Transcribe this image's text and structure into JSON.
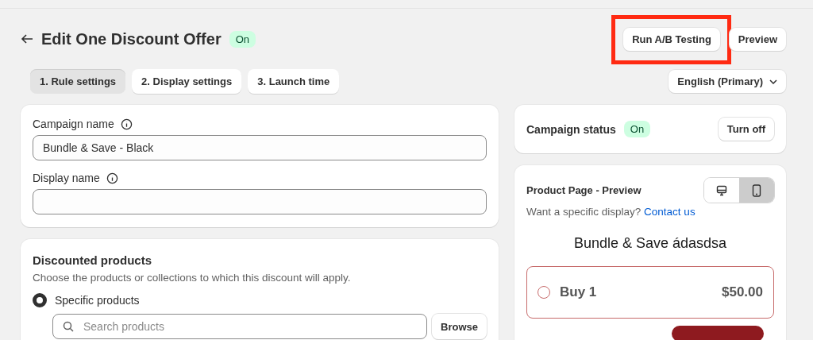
{
  "header": {
    "title": "Edit One Discount Offer",
    "status_badge": "On",
    "buttons": [
      {
        "label": "Run A/B Testing",
        "highlighted": true
      },
      {
        "label": "Preview",
        "highlighted": false
      }
    ]
  },
  "steps": [
    {
      "label": "1. Rule settings",
      "selected": true
    },
    {
      "label": "2. Display settings",
      "selected": false
    },
    {
      "label": "3. Launch time",
      "selected": false
    }
  ],
  "language_select": {
    "value": "English (Primary)"
  },
  "campaign_card": {
    "fields": [
      {
        "label": "Campaign name",
        "value": "Bundle & Save - Black"
      },
      {
        "label": "Display name"
      }
    ]
  },
  "discounted_products": {
    "title": "Discounted products",
    "description": "Choose the products or collections to which this discount will apply.",
    "options": [
      {
        "label": "Specific products",
        "selected": true
      }
    ],
    "search": {
      "placeholder": "Search products"
    },
    "browse_button": "Browse"
  },
  "campaign_status": {
    "label": "Campaign status",
    "badge": "On",
    "button": "Turn off"
  },
  "preview": {
    "title": "Product Page - Preview",
    "devices": [
      {
        "kind": "desktop",
        "selected": false
      },
      {
        "kind": "mobile",
        "selected": true
      }
    ],
    "hint": "Want a specific display?",
    "link": "Contact us",
    "offer_title": "Bundle & Save ádasdsa",
    "options": [
      {
        "label": "Buy 1",
        "price": "$50.00",
        "selected": false
      }
    ]
  }
}
